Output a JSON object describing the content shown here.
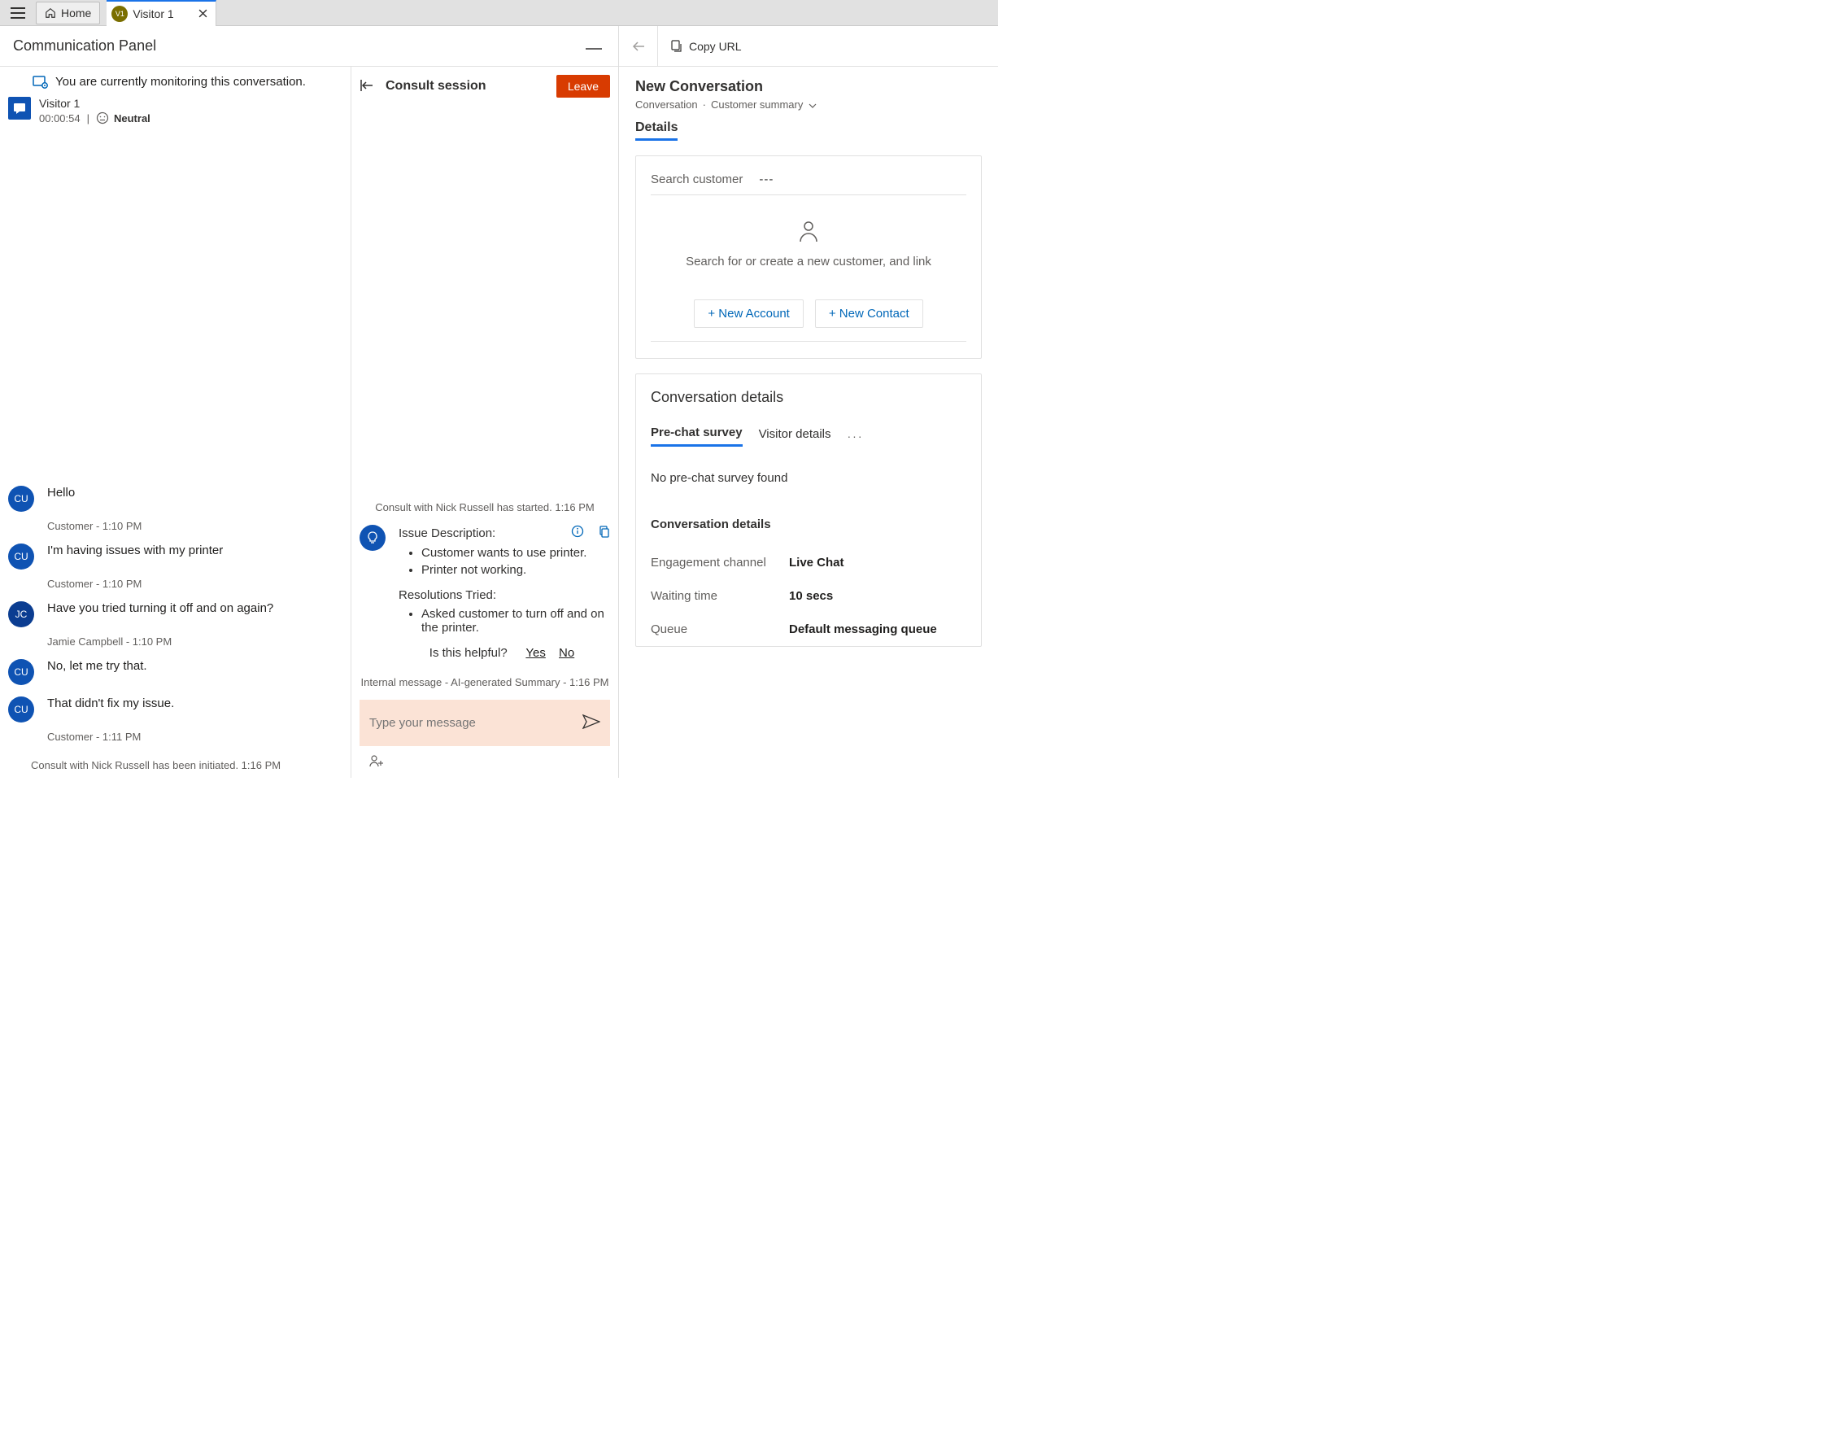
{
  "topbar": {
    "home_label": "Home",
    "session_badge": "V1",
    "session_label": "Visitor 1"
  },
  "comm_panel": {
    "title": "Communication Panel",
    "monitoring_text": "You are currently monitoring this conversation."
  },
  "visitor": {
    "name": "Visitor 1",
    "timer": "00:00:54",
    "sentiment": "Neutral"
  },
  "messages": [
    {
      "avatar": "CU",
      "avatar_class": "",
      "text": "Hello",
      "meta": "Customer - 1:10 PM"
    },
    {
      "avatar": "CU",
      "avatar_class": "",
      "text": "I'm having issues with my printer",
      "meta": "Customer - 1:10 PM"
    },
    {
      "avatar": "JC",
      "avatar_class": "jc",
      "text": "Have you tried turning it off and on again?",
      "meta": "Jamie Campbell - 1:10 PM"
    },
    {
      "avatar": "CU",
      "avatar_class": "",
      "text": "No, let me try that.",
      "meta": ""
    },
    {
      "avatar": "CU",
      "avatar_class": "",
      "text": "That didn't fix my issue.",
      "meta": "Customer - 1:11 PM"
    }
  ],
  "consult_initiated": "Consult with Nick Russell has been initiated. 1:16 PM",
  "consult": {
    "title": "Consult session",
    "leave": "Leave",
    "started": "Consult with Nick Russell has started. 1:16 PM",
    "issue_hdr": "Issue Description:",
    "issue_items": [
      "Customer wants to use printer.",
      "Printer not working."
    ],
    "res_hdr": "Resolutions Tried:",
    "res_items": [
      "Asked customer to turn off and on the printer."
    ],
    "helpful_q": "Is this helpful?",
    "yes": "Yes",
    "no": "No",
    "internal_meta": "Internal message - AI-generated Summary - 1:16 PM",
    "composer_placeholder": "Type your message"
  },
  "toolbar": {
    "copy_url": "Copy URL"
  },
  "right": {
    "title": "New Conversation",
    "bc1": "Conversation",
    "bc2": "Customer summary",
    "details_tab": "Details",
    "search_label": "Search customer",
    "search_value": "---",
    "search_hint": "Search for or create a new customer, and link",
    "new_account": "+ New Account",
    "new_contact": "+ New Contact",
    "conv_details_title": "Conversation details",
    "tab_prechat": "Pre-chat survey",
    "tab_visitor": "Visitor details",
    "no_prechat": "No pre-chat survey found",
    "sub_conv_details": "Conversation details",
    "rows": [
      {
        "k": "Engagement channel",
        "v": "Live Chat"
      },
      {
        "k": "Waiting time",
        "v": "10 secs"
      },
      {
        "k": "Queue",
        "v": "Default messaging queue"
      }
    ]
  }
}
